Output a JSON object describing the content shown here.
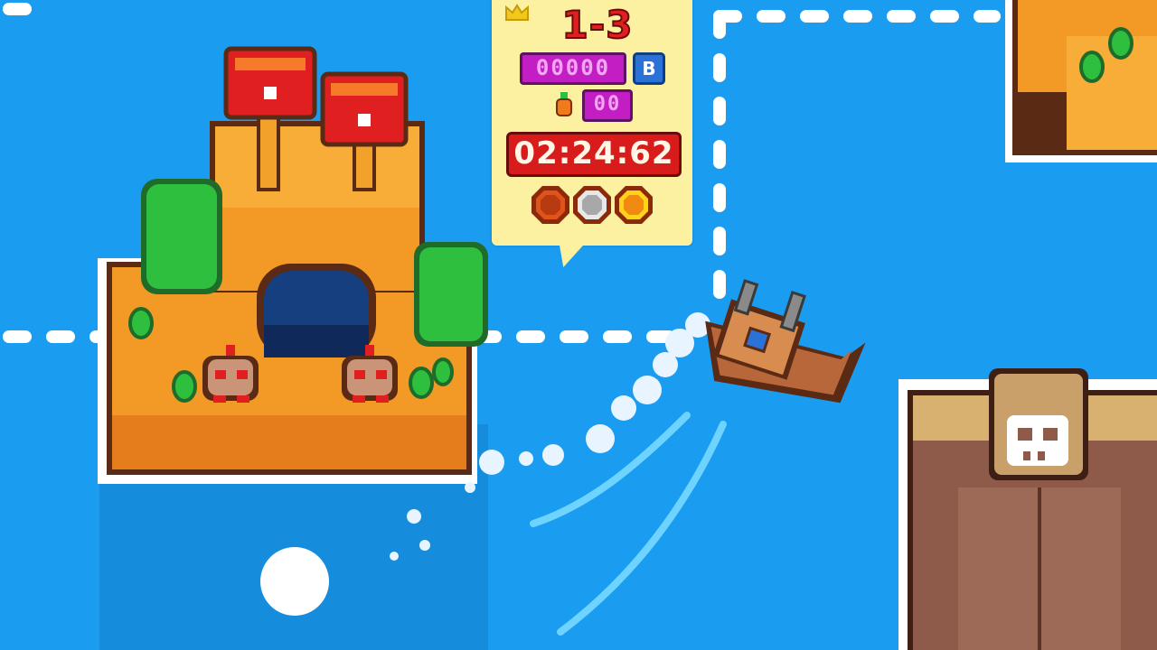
{
  "hud": {
    "level": "1-3",
    "collectibles": "00000",
    "rank": "B",
    "fruit_count": "00",
    "timer": "02:24:62",
    "medals": [
      "bronze",
      "silver",
      "gold"
    ]
  },
  "icons": {
    "crown": "crown-icon",
    "fruit": "carrot-icon",
    "medal_bronze": "bronze-medal-icon",
    "medal_silver": "silver-medal-icon",
    "medal_gold": "gold-medal-icon",
    "skull": "skull-icon",
    "joystick": "virtual-joystick-knob"
  },
  "colors": {
    "water": "#1a9cf0",
    "panel": "#fbf1a0",
    "level_text": "#e02020",
    "timer_bg": "#d81c1c",
    "bar_magenta": "#c31ec4",
    "rank_blue": "#2a72d8",
    "island_orange": "#f39a26",
    "bush_green": "#2fbf3f",
    "boat_brown": "#b8673a",
    "fortress_brown": "#8e5b4b"
  }
}
